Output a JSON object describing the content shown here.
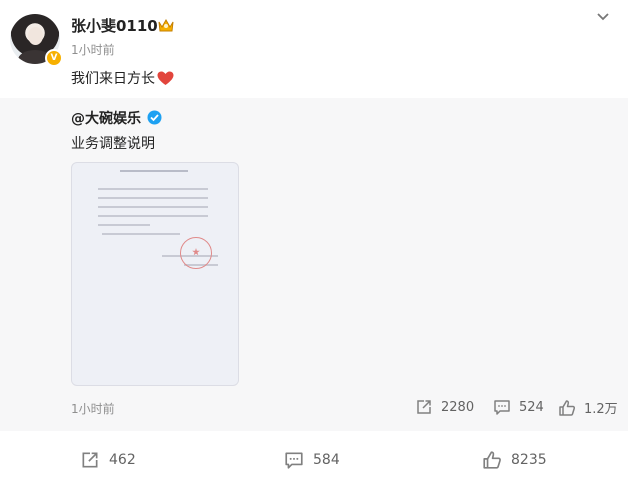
{
  "post": {
    "username": "张小斐0110",
    "time": "1小时前",
    "text": "我们来日方长"
  },
  "repost": {
    "username": "@大碗娱乐",
    "text": "业务调整说明",
    "time": "1小时前",
    "actions": {
      "forward": "2280",
      "comment": "524",
      "like": "1.2万"
    }
  },
  "actions": {
    "forward": "462",
    "comment": "584",
    "like": "8235"
  },
  "colors": {
    "accent_orange": "#f7b000",
    "heart": "#e2453c",
    "verified_blue": "#1da1f2",
    "seal": "#e08a8a"
  },
  "icons": [
    "avatar",
    "v-badge",
    "crown-icon",
    "chevron-down-icon",
    "heart-icon",
    "verified-icon",
    "forward-icon",
    "comment-icon",
    "like-icon"
  ]
}
